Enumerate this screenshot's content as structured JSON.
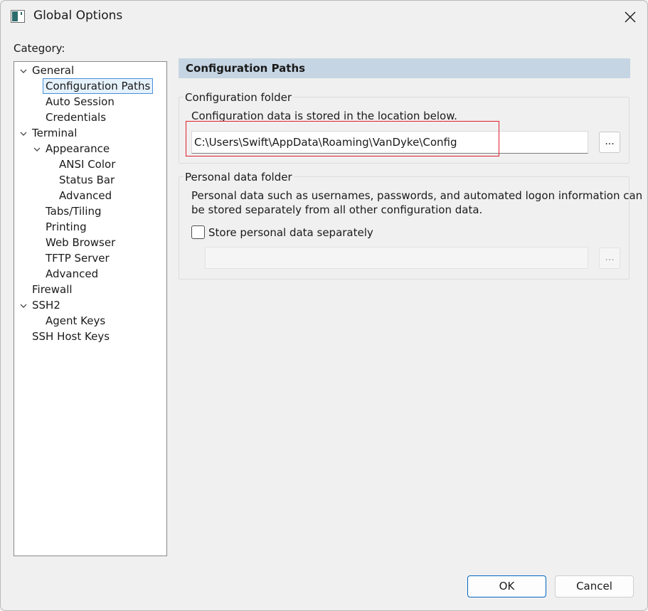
{
  "window": {
    "title": "Global Options",
    "close_label": "×"
  },
  "category_label": "Category:",
  "tree": [
    {
      "label": "General",
      "expanded": true
    },
    {
      "label": "Configuration Paths",
      "selected": true
    },
    {
      "label": "Auto Session"
    },
    {
      "label": "Credentials"
    },
    {
      "label": "Terminal",
      "expanded": true
    },
    {
      "label": "Appearance",
      "expanded": true
    },
    {
      "label": "ANSI Color"
    },
    {
      "label": "Status Bar"
    },
    {
      "label": "Advanced"
    },
    {
      "label": "Tabs/Tiling"
    },
    {
      "label": "Printing"
    },
    {
      "label": "Web Browser"
    },
    {
      "label": "TFTP Server"
    },
    {
      "label": "Advanced"
    },
    {
      "label": "Firewall"
    },
    {
      "label": "SSH2",
      "expanded": true
    },
    {
      "label": "Agent Keys"
    },
    {
      "label": "SSH Host Keys"
    }
  ],
  "panel": {
    "header": "Configuration Paths",
    "config_folder": {
      "title": "Configuration folder",
      "description": "Configuration data is stored in the location below.",
      "path_value": "C:\\Users\\Swift\\AppData\\Roaming\\VanDyke\\Config",
      "browse_label": "..."
    },
    "personal_folder": {
      "title": "Personal data folder",
      "description_line1": "Personal data such as usernames, passwords, and automated logon information can",
      "description_line2": "be stored separately from all other configuration data.",
      "checkbox_label": "Store personal data separately",
      "checkbox_checked": false,
      "path_value": "",
      "browse_label": "..."
    }
  },
  "buttons": {
    "ok": "OK",
    "cancel": "Cancel"
  },
  "colors": {
    "header_bg": "#c6d5e3",
    "highlight": "#e0202a",
    "selection_border": "#4a90d9"
  }
}
